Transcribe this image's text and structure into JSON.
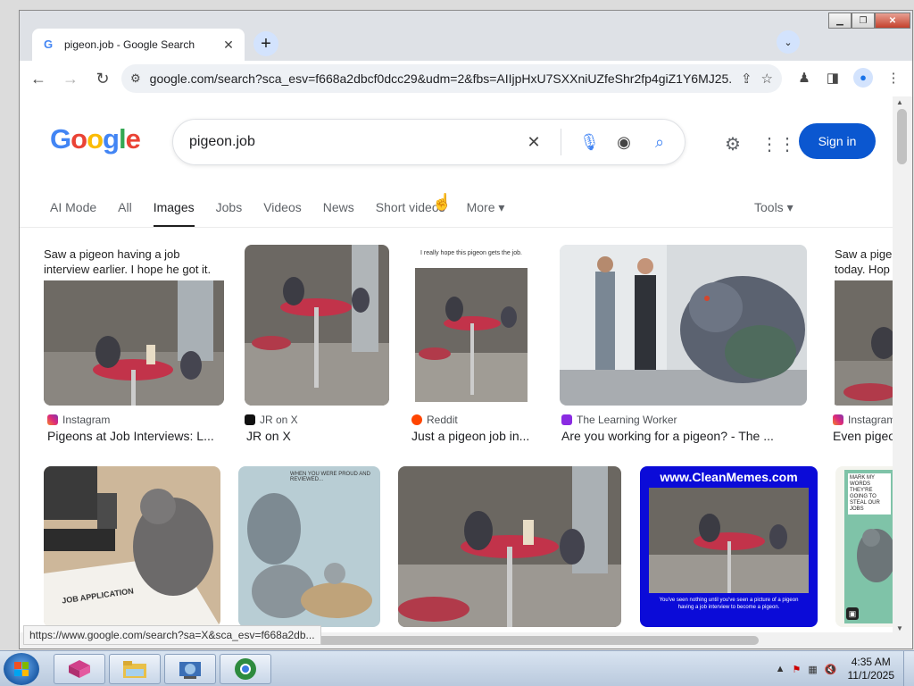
{
  "browser": {
    "tab_title": "pigeon.job - Google Search",
    "url": "google.com/search?sca_esv=f668a2dbcf0dcc29&udm=2&fbs=AIIjpHxU7SXXniUZfeShr2fp4giZ1Y6MJ25...",
    "status_url": "https://www.google.com/search?sa=X&sca_esv=f668a2db..."
  },
  "google": {
    "query": "pigeon.job",
    "sign_in": "Sign in",
    "tabs": [
      "AI Mode",
      "All",
      "Images",
      "Jobs",
      "Videos",
      "News",
      "Short videos",
      "More"
    ],
    "active_tab": "Images",
    "tools": "Tools"
  },
  "results": [
    {
      "source": "Instagram",
      "title": "Pigeons at Job Interviews: L...",
      "caption": "Saw a pigeon having a job interview earlier. I hope he got it."
    },
    {
      "source": "JR on X",
      "title": "JR on X"
    },
    {
      "source": "Reddit",
      "title": "Just a pigeon job in...",
      "caption": "I really hope this pigeon gets the job."
    },
    {
      "source": "The Learning Worker",
      "title": "Are you working for a pigeon? - The ..."
    },
    {
      "source": "Instagram",
      "title": "Even pigeo",
      "caption": "Saw a pige today. Hop"
    },
    {
      "source": "",
      "title": "",
      "caption": "JOB APPLICATION"
    },
    {
      "source": "",
      "title": "",
      "caption": "WHEN YOU WERE PROUD AND REVIEWED..."
    },
    {
      "source": "",
      "title": ""
    },
    {
      "source": "",
      "title": "",
      "caption": "www.CleanMemes.com",
      "subcaption": "You've seen nothing until you've seen a picture of a pigeon having a job interview to become a pigeon."
    },
    {
      "source": "",
      "title": "",
      "caption": "MARK MY WORDS THEY'RE GOING TO STEAL OUR JOBS"
    }
  ],
  "taskbar": {
    "time": "4:35 AM",
    "date": "11/1/2025"
  }
}
